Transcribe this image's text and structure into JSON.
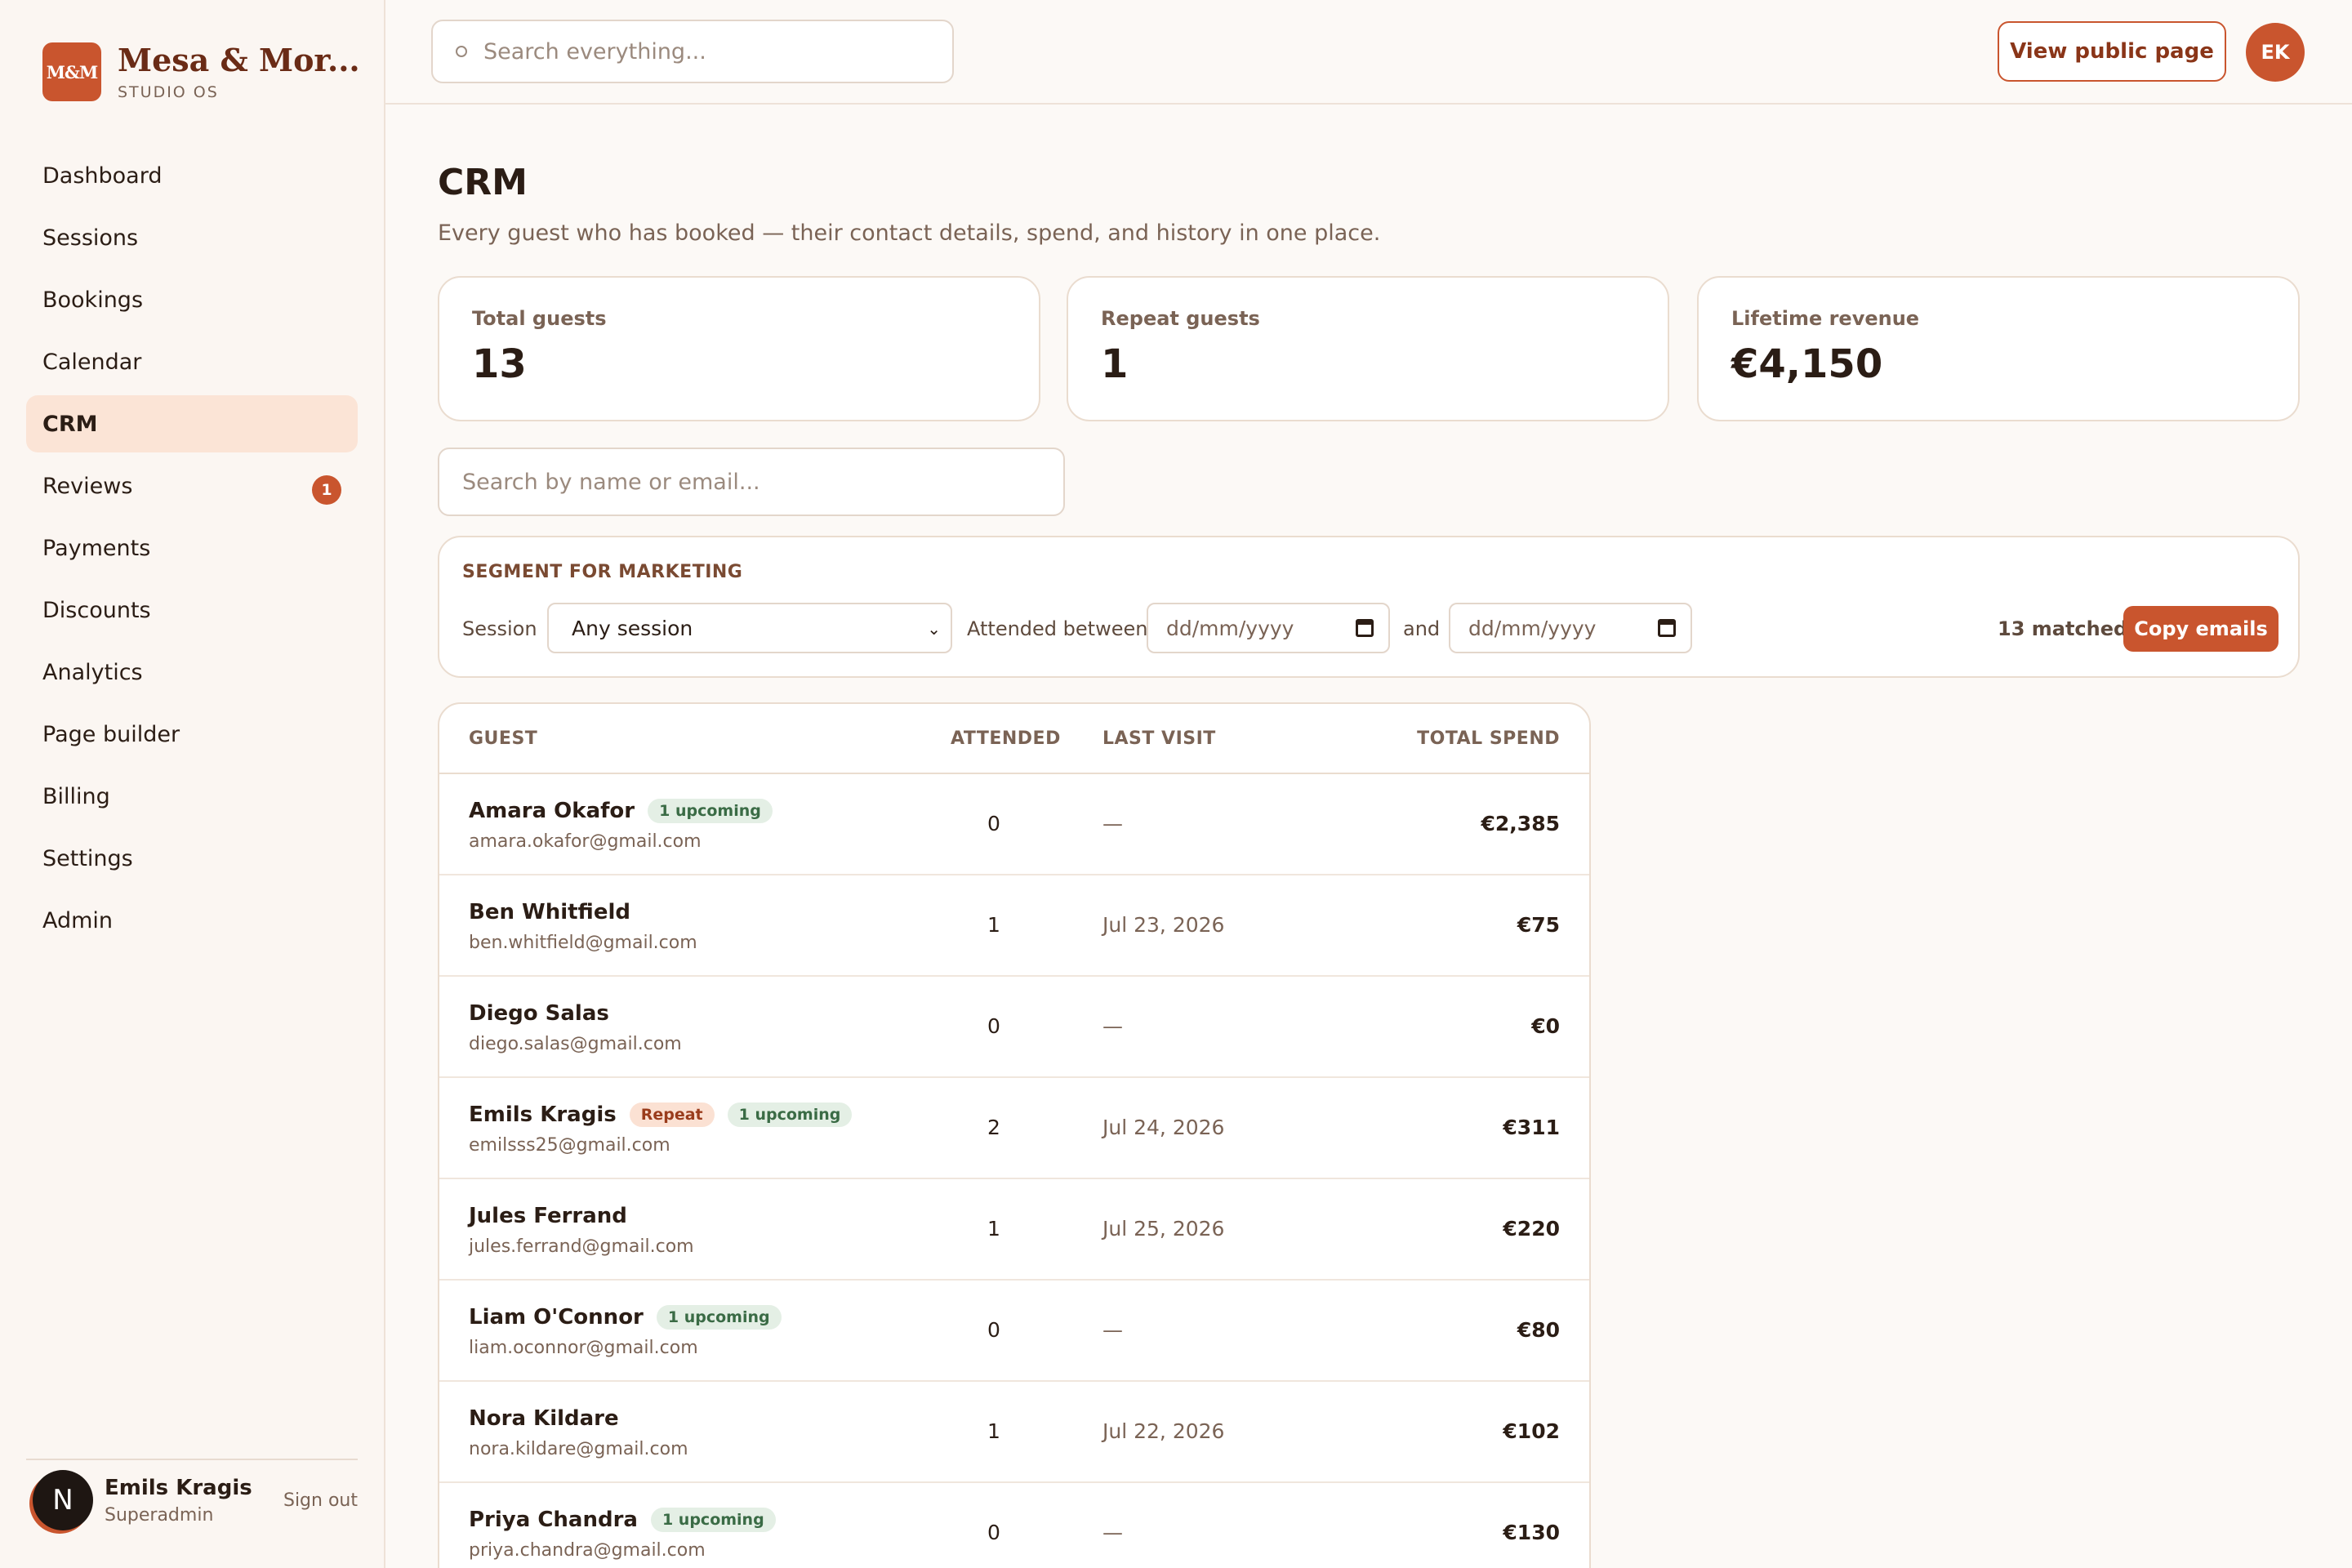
{
  "brand": {
    "logo": "M&M",
    "name": "Mesa & Mor...",
    "subtitle": "STUDIO OS"
  },
  "nav": [
    {
      "label": "Dashboard"
    },
    {
      "label": "Sessions"
    },
    {
      "label": "Bookings"
    },
    {
      "label": "Calendar"
    },
    {
      "label": "CRM",
      "active": true
    },
    {
      "label": "Reviews",
      "badge": "1"
    },
    {
      "label": "Payments"
    },
    {
      "label": "Discounts"
    },
    {
      "label": "Analytics"
    },
    {
      "label": "Page builder"
    },
    {
      "label": "Billing"
    },
    {
      "label": "Settings"
    },
    {
      "label": "Admin"
    }
  ],
  "user": {
    "initial": "N",
    "name": "Emils Kragis",
    "role": "Superadmin",
    "sign_out": "Sign out"
  },
  "topbar": {
    "search_placeholder": "Search everything...",
    "view_public": "View public page",
    "avatar": "EK"
  },
  "page": {
    "title": "CRM",
    "description": "Every guest who has booked — their contact details, spend, and history in one place."
  },
  "stats": [
    {
      "label": "Total guests",
      "value": "13"
    },
    {
      "label": "Repeat guests",
      "value": "1"
    },
    {
      "label": "Lifetime revenue",
      "value": "€4,150"
    }
  ],
  "crm_search_placeholder": "Search by name or email...",
  "segment": {
    "title": "SEGMENT FOR MARKETING",
    "session_label": "Session",
    "session_value": "Any session",
    "between_label": "Attended between",
    "date_placeholder": "dd/mm/yyyy",
    "and_label": "and",
    "matched": "13 matched",
    "copy_button": "Copy emails"
  },
  "table": {
    "headers": {
      "guest": "GUEST",
      "attended": "ATTENDED",
      "last_visit": "LAST VISIT",
      "total_spend": "TOTAL SPEND"
    },
    "rows": [
      {
        "name": "Amara Okafor",
        "email": "amara.okafor@gmail.com",
        "badges": [
          "1 upcoming"
        ],
        "attended": "0",
        "last_visit": "—",
        "spend": "€2,385"
      },
      {
        "name": "Ben Whitfield",
        "email": "ben.whitfield@gmail.com",
        "badges": [],
        "attended": "1",
        "last_visit": "Jul 23, 2026",
        "spend": "€75"
      },
      {
        "name": "Diego Salas",
        "email": "diego.salas@gmail.com",
        "badges": [],
        "attended": "0",
        "last_visit": "—",
        "spend": "€0"
      },
      {
        "name": "Emils Kragis",
        "email": "emilsss25@gmail.com",
        "badges": [
          "Repeat",
          "1 upcoming"
        ],
        "attended": "2",
        "last_visit": "Jul 24, 2026",
        "spend": "€311"
      },
      {
        "name": "Jules Ferrand",
        "email": "jules.ferrand@gmail.com",
        "badges": [],
        "attended": "1",
        "last_visit": "Jul 25, 2026",
        "spend": "€220"
      },
      {
        "name": "Liam O'Connor",
        "email": "liam.oconnor@gmail.com",
        "badges": [
          "1 upcoming"
        ],
        "attended": "0",
        "last_visit": "—",
        "spend": "€80"
      },
      {
        "name": "Nora Kildare",
        "email": "nora.kildare@gmail.com",
        "badges": [],
        "attended": "1",
        "last_visit": "Jul 22, 2026",
        "spend": "€102"
      },
      {
        "name": "Priya Chandra",
        "email": "priya.chandra@gmail.com",
        "badges": [
          "1 upcoming"
        ],
        "attended": "0",
        "last_visit": "—",
        "spend": "€130"
      }
    ]
  },
  "colors": {
    "accent": "#c9552e",
    "brand_dark": "#6a2b16",
    "active_nav_bg": "#fbe4d6",
    "upcoming_badge_bg": "#e4efe5",
    "repeat_badge_bg": "#fbe1d3"
  }
}
